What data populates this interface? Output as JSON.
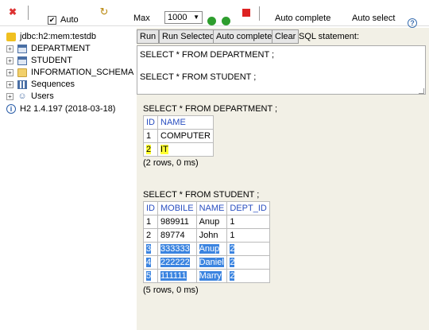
{
  "toolbar": {
    "auto_commit_label": "Auto",
    "max_label": "Max",
    "max_rows_value": "1000",
    "auto_complete_label": "Auto complete",
    "auto_select_label": "Auto select"
  },
  "tree": {
    "connection": "jdbc:h2:mem:testdb",
    "items": [
      {
        "label": "DEPARTMENT",
        "icon": "table-icon"
      },
      {
        "label": "STUDENT",
        "icon": "table-icon"
      },
      {
        "label": "INFORMATION_SCHEMA",
        "icon": "folder-icon"
      },
      {
        "label": "Sequences",
        "icon": "sequences-icon"
      },
      {
        "label": "Users",
        "icon": "users-icon"
      }
    ],
    "version": "H2 1.4.197 (2018-03-18)"
  },
  "buttons": {
    "run": "Run",
    "run_selected": "Run Selected",
    "auto_complete": "Auto complete",
    "clear": "Clear",
    "sql_statement_label": "SQL statement:"
  },
  "sql_text": "SELECT * FROM DEPARTMENT ;\n\nSELECT * FROM STUDENT ;",
  "results": [
    {
      "query": "SELECT * FROM DEPARTMENT ;",
      "columns": [
        "ID",
        "NAME"
      ],
      "rows": [
        [
          "1",
          "COMPUTER"
        ],
        [
          "2",
          "IT"
        ]
      ],
      "summary": "(2 rows, 0 ms)"
    },
    {
      "query": "SELECT * FROM STUDENT ;",
      "columns": [
        "ID",
        "MOBILE",
        "NAME",
        "DEPT_ID"
      ],
      "rows": [
        [
          "1",
          "989911",
          "Anup",
          "1"
        ],
        [
          "2",
          "89774",
          "John",
          "1"
        ],
        [
          "3",
          "333333",
          "Anup",
          "2"
        ],
        [
          "4",
          "222222",
          "Daniel",
          "2"
        ],
        [
          "5",
          "111111",
          "Marry",
          "2"
        ]
      ],
      "summary": "(5 rows, 0 ms)"
    }
  ],
  "colors": {
    "highlight_yellow": "#ffff33",
    "highlight_blue": "#3b84e0",
    "header_blue": "#2a4fc0",
    "panel_bg": "#f2f0e6"
  }
}
